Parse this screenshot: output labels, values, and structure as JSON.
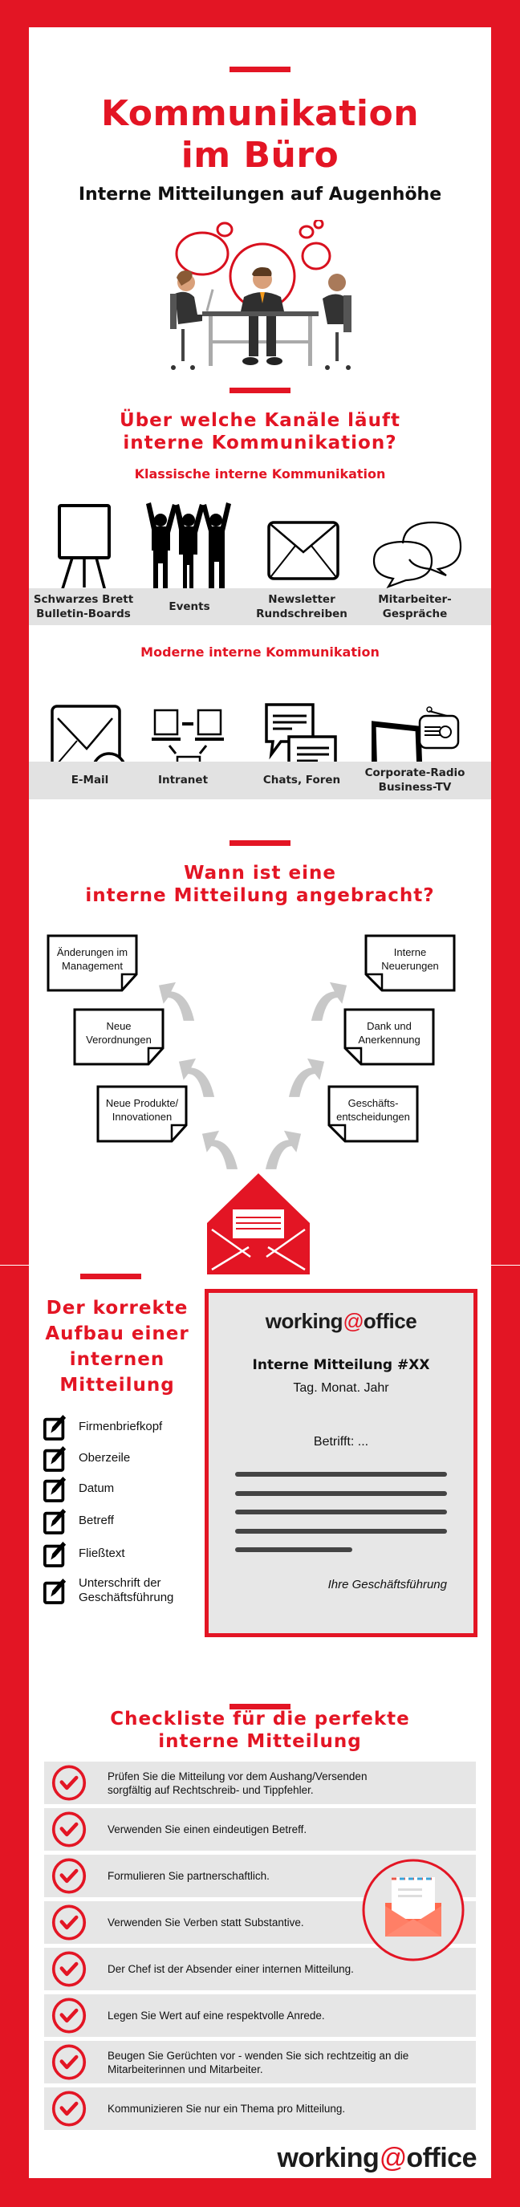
{
  "header": {
    "title_line1": "Kommunikation",
    "title_line2": "im Büro",
    "subtitle": "Interne Mitteilungen auf Augenhöhe"
  },
  "channels": {
    "heading_line1": "Über welche Kanäle läuft",
    "heading_line2": "interne Kommunikation?",
    "classic": {
      "heading": "Klassische interne Kommunikation",
      "items": [
        {
          "icon": "easel-board-icon",
          "label_line1": "Schwarzes Brett",
          "label_line2": "Bulletin-Boards"
        },
        {
          "icon": "people-cheering-icon",
          "label_line1": "Events",
          "label_line2": ""
        },
        {
          "icon": "envelope-icon",
          "label_line1": "Newsletter",
          "label_line2": "Rundschreiben"
        },
        {
          "icon": "speech-bubbles-icon",
          "label_line1": "Mitarbeiter-",
          "label_line2": "Gespräche"
        }
      ]
    },
    "modern": {
      "heading": "Moderne interne Kommunikation",
      "items": [
        {
          "icon": "email-at-icon",
          "label_line1": "E-Mail",
          "label_line2": ""
        },
        {
          "icon": "network-computers-icon",
          "label_line1": "Intranet",
          "label_line2": ""
        },
        {
          "icon": "chat-bubbles-icon",
          "label_line1": "Chats, Foren",
          "label_line2": ""
        },
        {
          "icon": "tv-radio-icon",
          "label_line1": "Corporate-Radio",
          "label_line2": "Business-TV"
        }
      ]
    }
  },
  "occasions": {
    "heading_line1": "Wann ist eine",
    "heading_line2": "interne Mitteilung angebracht?",
    "left": [
      {
        "line1": "Änderungen im",
        "line2": "Management"
      },
      {
        "line1": "Neue",
        "line2": "Verordnungen"
      },
      {
        "line1": "Neue Produkte/",
        "line2": "Innovationen"
      }
    ],
    "right": [
      {
        "line1": "Interne",
        "line2": "Neuerungen"
      },
      {
        "line1": "Dank und",
        "line2": "Anerkennung"
      },
      {
        "line1": "Geschäfts-",
        "line2": "entscheidungen"
      }
    ]
  },
  "structure": {
    "heading_lines": [
      "Der korrekte",
      "Aufbau einer",
      "internen",
      "Mitteilung"
    ],
    "items": [
      {
        "line1": "Firmenbriefkopf",
        "line2": ""
      },
      {
        "line1": "Oberzeile",
        "line2": ""
      },
      {
        "line1": "Datum",
        "line2": ""
      },
      {
        "line1": "Betreff",
        "line2": ""
      },
      {
        "line1": "Fließtext",
        "line2": ""
      },
      {
        "line1": "Unterschrift der",
        "line2": "Geschäftsführung"
      }
    ],
    "letter": {
      "logo_left": "working",
      "logo_at": "@",
      "logo_right": "office",
      "title": "Interne Mitteilung #XX",
      "date": "Tag. Monat. Jahr",
      "subject": "Betrifft: ...",
      "signature": "Ihre Geschäftsführung"
    }
  },
  "checklist": {
    "heading_line1": "Checkliste für die perfekte",
    "heading_line2": "interne Mitteilung",
    "items": [
      {
        "line1": "Prüfen Sie die Mitteilung vor dem Aushang/Versenden",
        "line2": "sorgfältig auf Rechtschreib- und Tippfehler."
      },
      {
        "line1": "Verwenden Sie einen eindeutigen Betreff.",
        "line2": ""
      },
      {
        "line1": "Formulieren Sie partnerschaftlich.",
        "line2": ""
      },
      {
        "line1": "Verwenden Sie Verben statt Substantive.",
        "line2": ""
      },
      {
        "line1": "Der Chef ist der Absender einer internen Mitteilung.",
        "line2": ""
      },
      {
        "line1": "Legen Sie Wert auf eine respektvolle Anrede.",
        "line2": ""
      },
      {
        "line1": "Beugen Sie Gerüchten vor - wenden Sie sich rechtzeitig an die",
        "line2": "Mitarbeiterinnen und Mitarbeiter."
      },
      {
        "line1": "Kommunizieren Sie nur ein Thema pro Mitteilung.",
        "line2": ""
      }
    ]
  },
  "footer": {
    "logo_left": "working",
    "logo_at": "@",
    "logo_right": "office"
  },
  "colors": {
    "brand_red": "#e31524",
    "band_gray": "#e2e2e2",
    "arrow_gray": "#c8c8c8"
  }
}
